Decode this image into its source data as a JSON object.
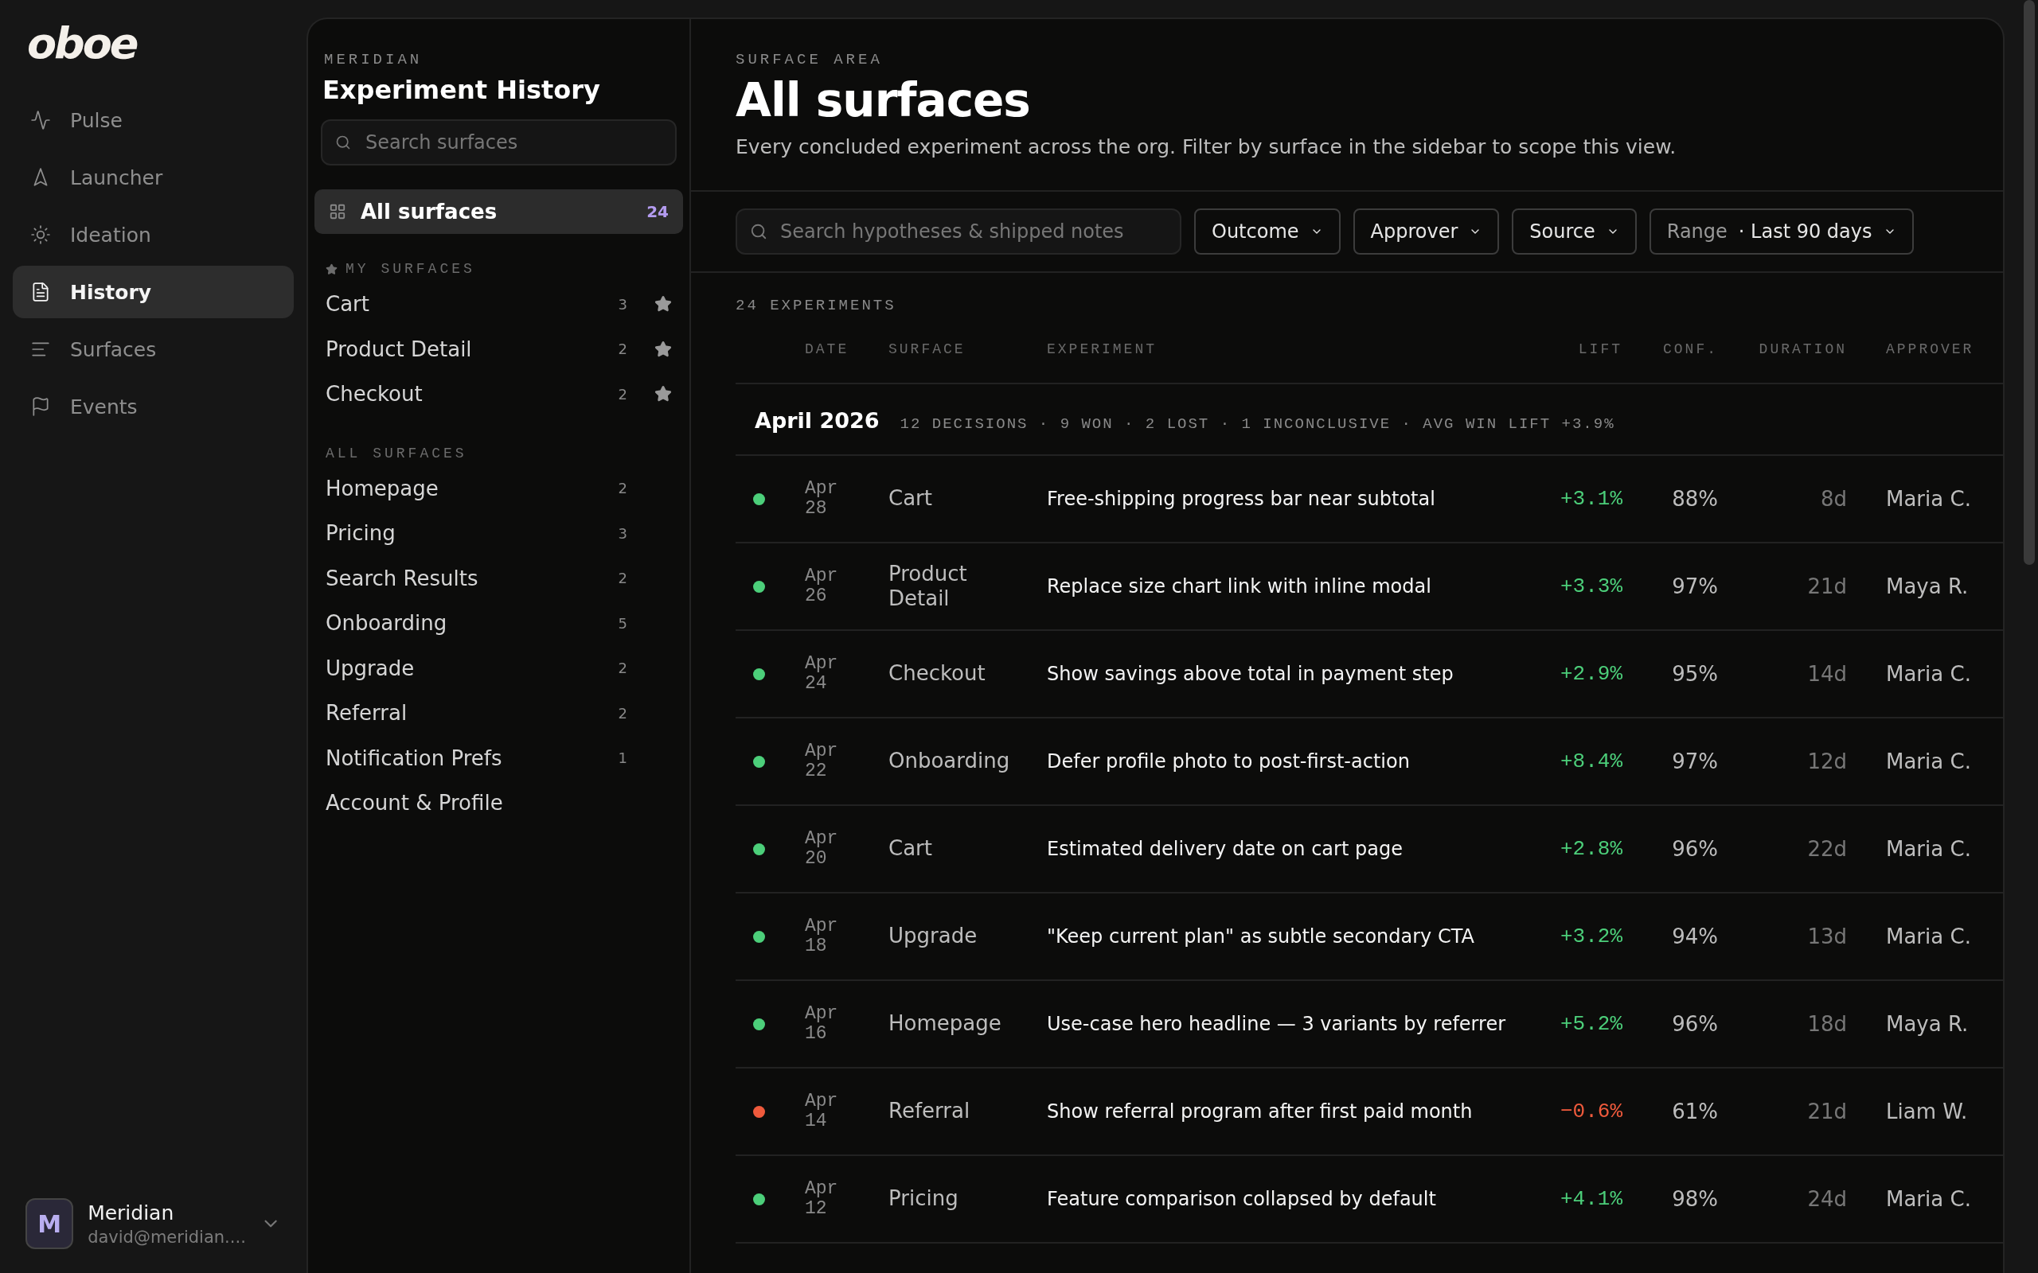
{
  "brand": {
    "logo": "oboe"
  },
  "nav": [
    {
      "label": "Pulse",
      "selected": false
    },
    {
      "label": "Launcher",
      "selected": false
    },
    {
      "label": "Ideation",
      "selected": false
    },
    {
      "label": "History",
      "selected": true
    },
    {
      "label": "Surfaces",
      "selected": false
    },
    {
      "label": "Events",
      "selected": false
    }
  ],
  "account": {
    "avatar": "M",
    "name": "Meridian",
    "email": "david@meridian...."
  },
  "sidebar": {
    "eyebrow": "MERIDIAN",
    "title": "Experiment History",
    "search": {
      "placeholder": "Search surfaces"
    },
    "all": {
      "label": "All surfaces",
      "count": "24",
      "selected": true
    },
    "my_heading": "MY SURFACES",
    "my_surfaces": [
      {
        "label": "Cart",
        "count": "3",
        "starred": true
      },
      {
        "label": "Product Detail",
        "count": "2",
        "starred": true
      },
      {
        "label": "Checkout",
        "count": "2",
        "starred": true
      }
    ],
    "all_heading": "ALL SURFACES",
    "all_surfaces": [
      {
        "label": "Homepage",
        "count": "2"
      },
      {
        "label": "Pricing",
        "count": "3"
      },
      {
        "label": "Search Results",
        "count": "2"
      },
      {
        "label": "Onboarding",
        "count": "5"
      },
      {
        "label": "Upgrade",
        "count": "2"
      },
      {
        "label": "Referral",
        "count": "2"
      },
      {
        "label": "Notification Prefs",
        "count": "1"
      },
      {
        "label": "Account & Profile"
      }
    ]
  },
  "header": {
    "eyebrow": "SURFACE AREA",
    "title": "All surfaces",
    "subtitle": "Every concluded experiment across the org. Filter by surface in the sidebar to scope this view."
  },
  "filters": {
    "search": {
      "placeholder": "Search hypotheses & shipped notes"
    },
    "dropdowns": [
      {
        "label": "Outcome"
      },
      {
        "label": "Approver"
      },
      {
        "label": "Source"
      },
      {
        "label": "Range",
        "value": "· Last 90 days"
      }
    ]
  },
  "table": {
    "count": "24 EXPERIMENTS",
    "columns": [
      "DATE",
      "SURFACE",
      "EXPERIMENT",
      "LIFT",
      "CONF.",
      "DURATION",
      "APPROVER"
    ],
    "groups": [
      {
        "title": "April 2026",
        "summary": "12 DECISIONS · 9 WON · 2 LOST · 1 INCONCLUSIVE · AVG WIN LIFT +3.9%",
        "rows": [
          {
            "color": "#4ccf7a",
            "month": "Apr",
            "day": "28",
            "surface": "Cart",
            "experiment": "Free-shipping progress bar near subtotal",
            "lift": "+3.1%",
            "conf": "88%",
            "duration": "8d",
            "approver": "Maria C."
          },
          {
            "color": "#4ccf7a",
            "month": "Apr",
            "day": "26",
            "surface": "Product Detail",
            "experiment": "Replace size chart link with inline modal",
            "lift": "+3.3%",
            "conf": "97%",
            "duration": "21d",
            "approver": "Maya R."
          },
          {
            "color": "#4ccf7a",
            "month": "Apr",
            "day": "24",
            "surface": "Checkout",
            "experiment": "Show savings above total in payment step",
            "lift": "+2.9%",
            "conf": "95%",
            "duration": "14d",
            "approver": "Maria C."
          },
          {
            "color": "#4ccf7a",
            "month": "Apr",
            "day": "22",
            "surface": "Onboarding",
            "experiment": "Defer profile photo to post-first-action",
            "lift": "+8.4%",
            "conf": "97%",
            "duration": "12d",
            "approver": "Maria C."
          },
          {
            "color": "#4ccf7a",
            "month": "Apr",
            "day": "20",
            "surface": "Cart",
            "experiment": "Estimated delivery date on cart page",
            "lift": "+2.8%",
            "conf": "96%",
            "duration": "22d",
            "approver": "Maria C."
          },
          {
            "color": "#4ccf7a",
            "month": "Apr",
            "day": "18",
            "surface": "Upgrade",
            "experiment": "\"Keep current plan\" as subtle secondary CTA",
            "lift": "+3.2%",
            "conf": "94%",
            "duration": "13d",
            "approver": "Maria C."
          },
          {
            "color": "#4ccf7a",
            "month": "Apr",
            "day": "16",
            "surface": "Homepage",
            "experiment": "Use-case hero headline — 3 variants by referrer",
            "lift": "+5.2%",
            "conf": "96%",
            "duration": "18d",
            "approver": "Maya R."
          },
          {
            "color": "#ef5a3c",
            "month": "Apr",
            "day": "14",
            "surface": "Referral",
            "experiment": "Show referral program after first paid month",
            "lift": "−0.6%",
            "conf": "61%",
            "duration": "21d",
            "approver": "Liam W."
          },
          {
            "color": "#4ccf7a",
            "month": "Apr",
            "day": "12",
            "surface": "Pricing",
            "experiment": "Feature comparison collapsed by default",
            "lift": "+4.1%",
            "conf": "98%",
            "duration": "24d",
            "approver": "Maria C."
          }
        ]
      }
    ]
  }
}
